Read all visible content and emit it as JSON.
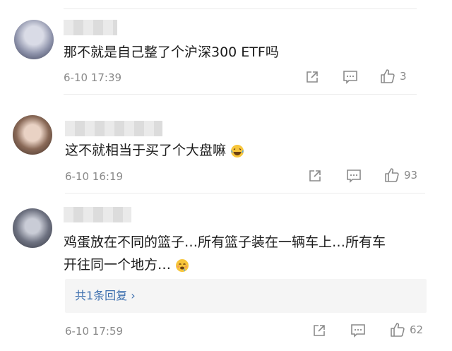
{
  "comments": [
    {
      "text": "那不就是自己整了个沪深300 ETF吗",
      "time": "6-10 17:39",
      "likes": "3"
    },
    {
      "text": "这不就相当于买了个大盘嘛",
      "time": "6-10 16:19",
      "likes": "93",
      "emoji": "laughing-emoji"
    },
    {
      "text_line1": "鸡蛋放在不同的篮子…所有篮子装在一辆车上…所有车",
      "text_line2": "开往同一个地方…",
      "time": "6-10 17:59",
      "likes": "62",
      "emoji": "drooling-emoji",
      "reply_label": "共1条回复 ›"
    }
  ],
  "icons": {
    "share": "share-icon",
    "comment": "comment-icon",
    "like": "thumbs-up-icon"
  },
  "colors": {
    "text": "#1b1b1b",
    "meta": "#8a8a8a",
    "reply_link": "#3d6fae",
    "reply_bg": "#f5f5f5"
  }
}
